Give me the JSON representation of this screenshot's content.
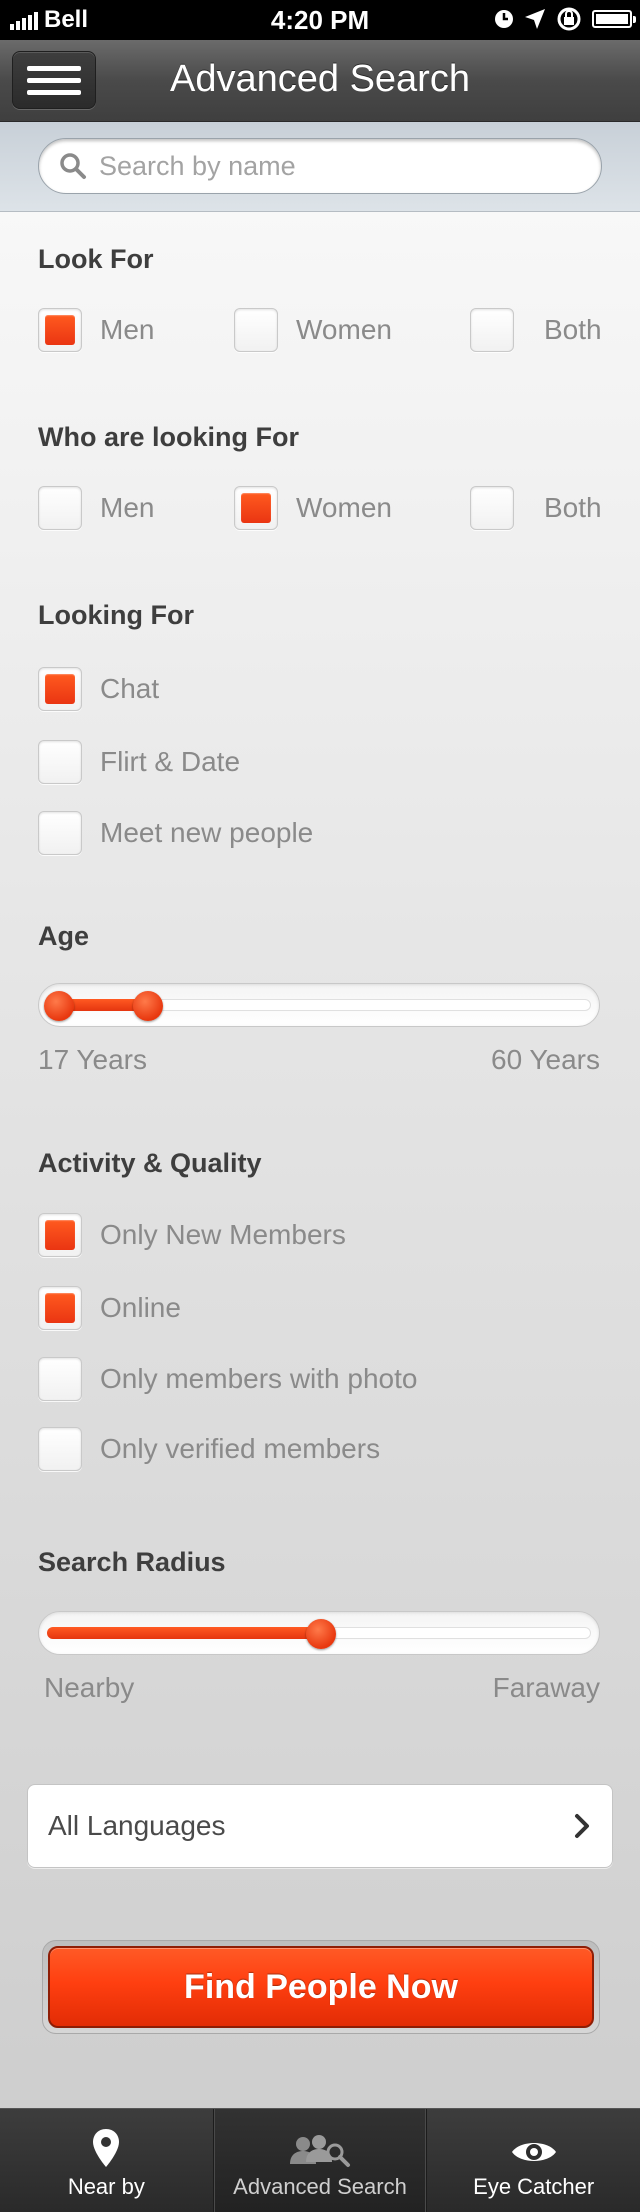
{
  "status_bar": {
    "carrier": "Bell",
    "time": "4:20 PM"
  },
  "nav": {
    "title": "Advanced Search",
    "menu_icon": "hamburger-menu-icon"
  },
  "search": {
    "placeholder": "Search by name",
    "value": ""
  },
  "look_for": {
    "title": "Look For",
    "options": [
      {
        "label": "Men",
        "checked": true
      },
      {
        "label": "Women",
        "checked": false
      },
      {
        "label": "Both",
        "checked": false
      }
    ]
  },
  "who_looking_for": {
    "title": "Who are looking For",
    "options": [
      {
        "label": "Men",
        "checked": false
      },
      {
        "label": "Women",
        "checked": true
      },
      {
        "label": "Both",
        "checked": false
      }
    ]
  },
  "looking_for": {
    "title": "Looking For",
    "options": [
      {
        "label": "Chat",
        "checked": true
      },
      {
        "label": "Flirt & Date",
        "checked": false
      },
      {
        "label": "Meet new people",
        "checked": false
      }
    ]
  },
  "age": {
    "title": "Age",
    "min_label": "17 Years",
    "max_label": "60 Years",
    "range_low": 0.0,
    "range_high": 0.17
  },
  "activity": {
    "title": "Activity & Quality",
    "options": [
      {
        "label": "Only New Members",
        "checked": true
      },
      {
        "label": "Online",
        "checked": true
      },
      {
        "label": "Only members with photo",
        "checked": false
      },
      {
        "label": "Only verified members",
        "checked": false
      }
    ]
  },
  "radius": {
    "title": "Search Radius",
    "min_label": "Nearby",
    "max_label": "Faraway",
    "value": 0.5
  },
  "language": {
    "label": "All Languages"
  },
  "find_button": {
    "label": "Find People Now"
  },
  "tabs": [
    {
      "label": "Near by",
      "icon": "map-pin-icon",
      "active": false
    },
    {
      "label": "Advanced Search",
      "icon": "people-search-icon",
      "active": true
    },
    {
      "label": "Eye Catcher",
      "icon": "eye-icon",
      "active": false
    }
  ],
  "colors": {
    "accent": "#ff4a1a",
    "navbar": "#4a4a4a",
    "tabbar": "#2e2e2e"
  }
}
